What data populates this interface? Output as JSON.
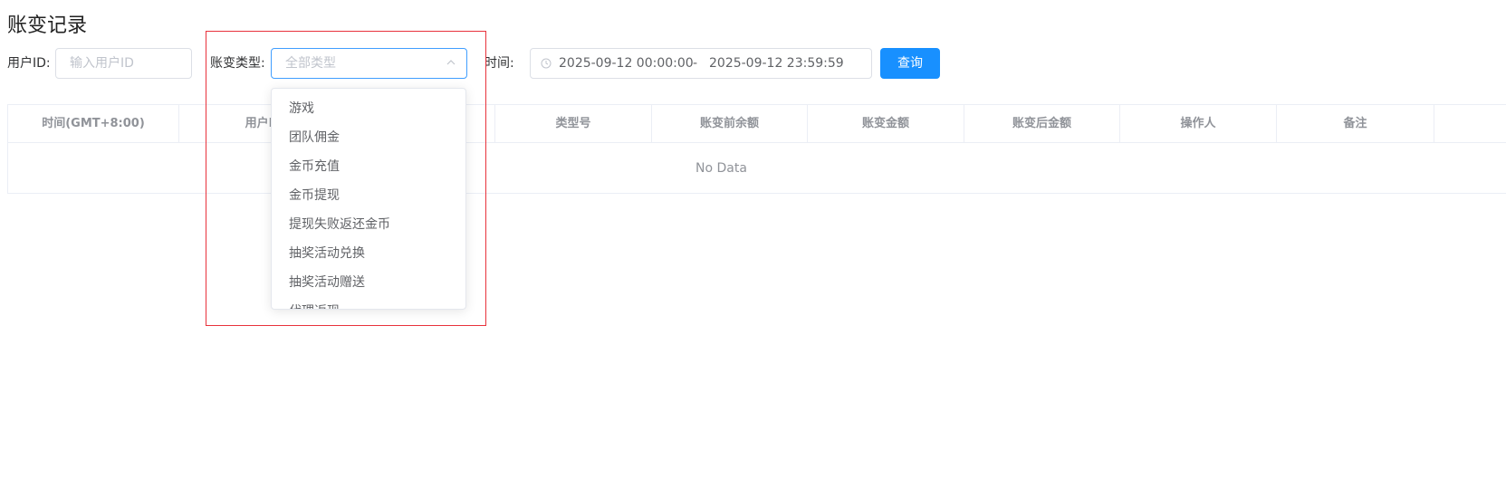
{
  "page": {
    "title": "账变记录"
  },
  "filters": {
    "user_id_label": "用户ID:",
    "user_id_placeholder": "输入用户ID",
    "type_label": "账变类型:",
    "type_placeholder": "全部类型",
    "time_label": "时间:",
    "date_start": "2025-09-12 00:00:00",
    "date_sep": "-",
    "date_end": "2025-09-12 23:59:59",
    "query_button": "查询"
  },
  "table": {
    "columns": [
      "时间(GMT+8:00)",
      "用户ID",
      "",
      "类型号",
      "账变前余额",
      "账变金额",
      "账变后金额",
      "操作人",
      "备注"
    ],
    "empty_text": "No Data"
  },
  "dropdown": {
    "options": [
      "游戏",
      "团队佣金",
      "金币充值",
      "金币提现",
      "提现失败返还金币",
      "抽奖活动兑换",
      "抽奖活动赠送",
      "代理返现"
    ]
  },
  "colors": {
    "primary": "#1890ff",
    "highlight_border": "#e8323c"
  }
}
